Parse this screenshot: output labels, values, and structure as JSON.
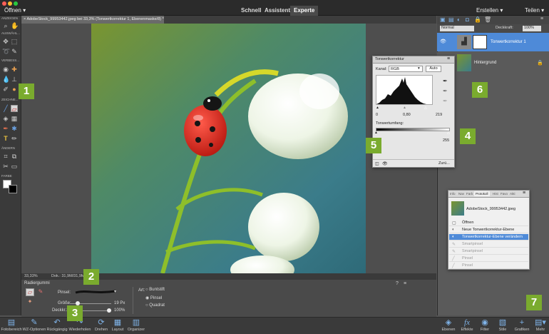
{
  "menubar": {
    "open_label": "Öffnen",
    "create_label": "Erstellen",
    "share_label": "Teilen"
  },
  "modes": [
    {
      "label": "Schnell"
    },
    {
      "label": "Assistent"
    },
    {
      "label": "Experte"
    }
  ],
  "document_tab": {
    "title": "AdobeStock_99953442.jpeg bei 33,3% (Tonwertkorrektur 1, Ebenenmaske/8) *"
  },
  "toolbox": {
    "sections": [
      "ANZEIGEN",
      "AUSWÄHL...",
      "VERBESS...",
      "ZEICHNE...",
      "ÄNDERN",
      "FARBE"
    ]
  },
  "statusbar": {
    "zoom": "33,33%",
    "doc": "Dok.: 31,9M/31,9M"
  },
  "tool_options": {
    "tool_name": "Radiergummi",
    "brush_label": "Pinsel:",
    "size_label": "Größe:",
    "size_value": "19 Px",
    "opacity_label": "Deckkr.:",
    "opacity_value": "100%",
    "type_label": "Art:",
    "types": [
      "Buntstift",
      "Pinsel",
      "Quadrat"
    ],
    "selected_type": "Pinsel"
  },
  "layers": {
    "blend_mode": "Normal",
    "opacity_label": "Deckkraft:",
    "opacity_value": "100%",
    "items": [
      {
        "name": "Tonwertkorrektur 1"
      },
      {
        "name": "Hintergrund"
      }
    ]
  },
  "levels_panel": {
    "title": "Tonwertkorrektur",
    "channel_label": "Kanal:",
    "channel_value": "RGB",
    "auto_label": "Auto",
    "input_values": [
      "0",
      "0,80",
      "219"
    ],
    "output_label": "Tonwertumfang:",
    "output_values": [
      "0",
      "255"
    ],
    "reset_label": "Zurü..."
  },
  "history_panel": {
    "tabs": [
      "Info",
      "Nav",
      "Farb",
      "Protokoll",
      "Hist",
      "Favo",
      "Akti"
    ],
    "active_tab": "Protokoll",
    "snapshot_name": "AdobeStock_99953442.jpeg",
    "items": [
      "Öffnen",
      "Neue Tonwertkorrektur-Ebene",
      "Tonwertkorrektur-Ebene verändern",
      "Smartpinsel",
      "Smartpinsel",
      "Pinsel",
      "Pinsel"
    ],
    "selected_index": 2
  },
  "bottom_bar": {
    "left": [
      "Fotobereich",
      "WZ-Optionen",
      "Rückgängig",
      "Wiederholen",
      "Drehen",
      "Layout",
      "Organizer"
    ],
    "right": [
      "Ebenen",
      "Effekte",
      "Filter",
      "Stile",
      "Grafiken",
      "Mehr"
    ]
  },
  "callouts": [
    "1",
    "2",
    "3",
    "4",
    "5",
    "6",
    "7"
  ],
  "colors": {
    "accent_blue": "#4e8ad8",
    "callout_green": "#7aab2e"
  }
}
